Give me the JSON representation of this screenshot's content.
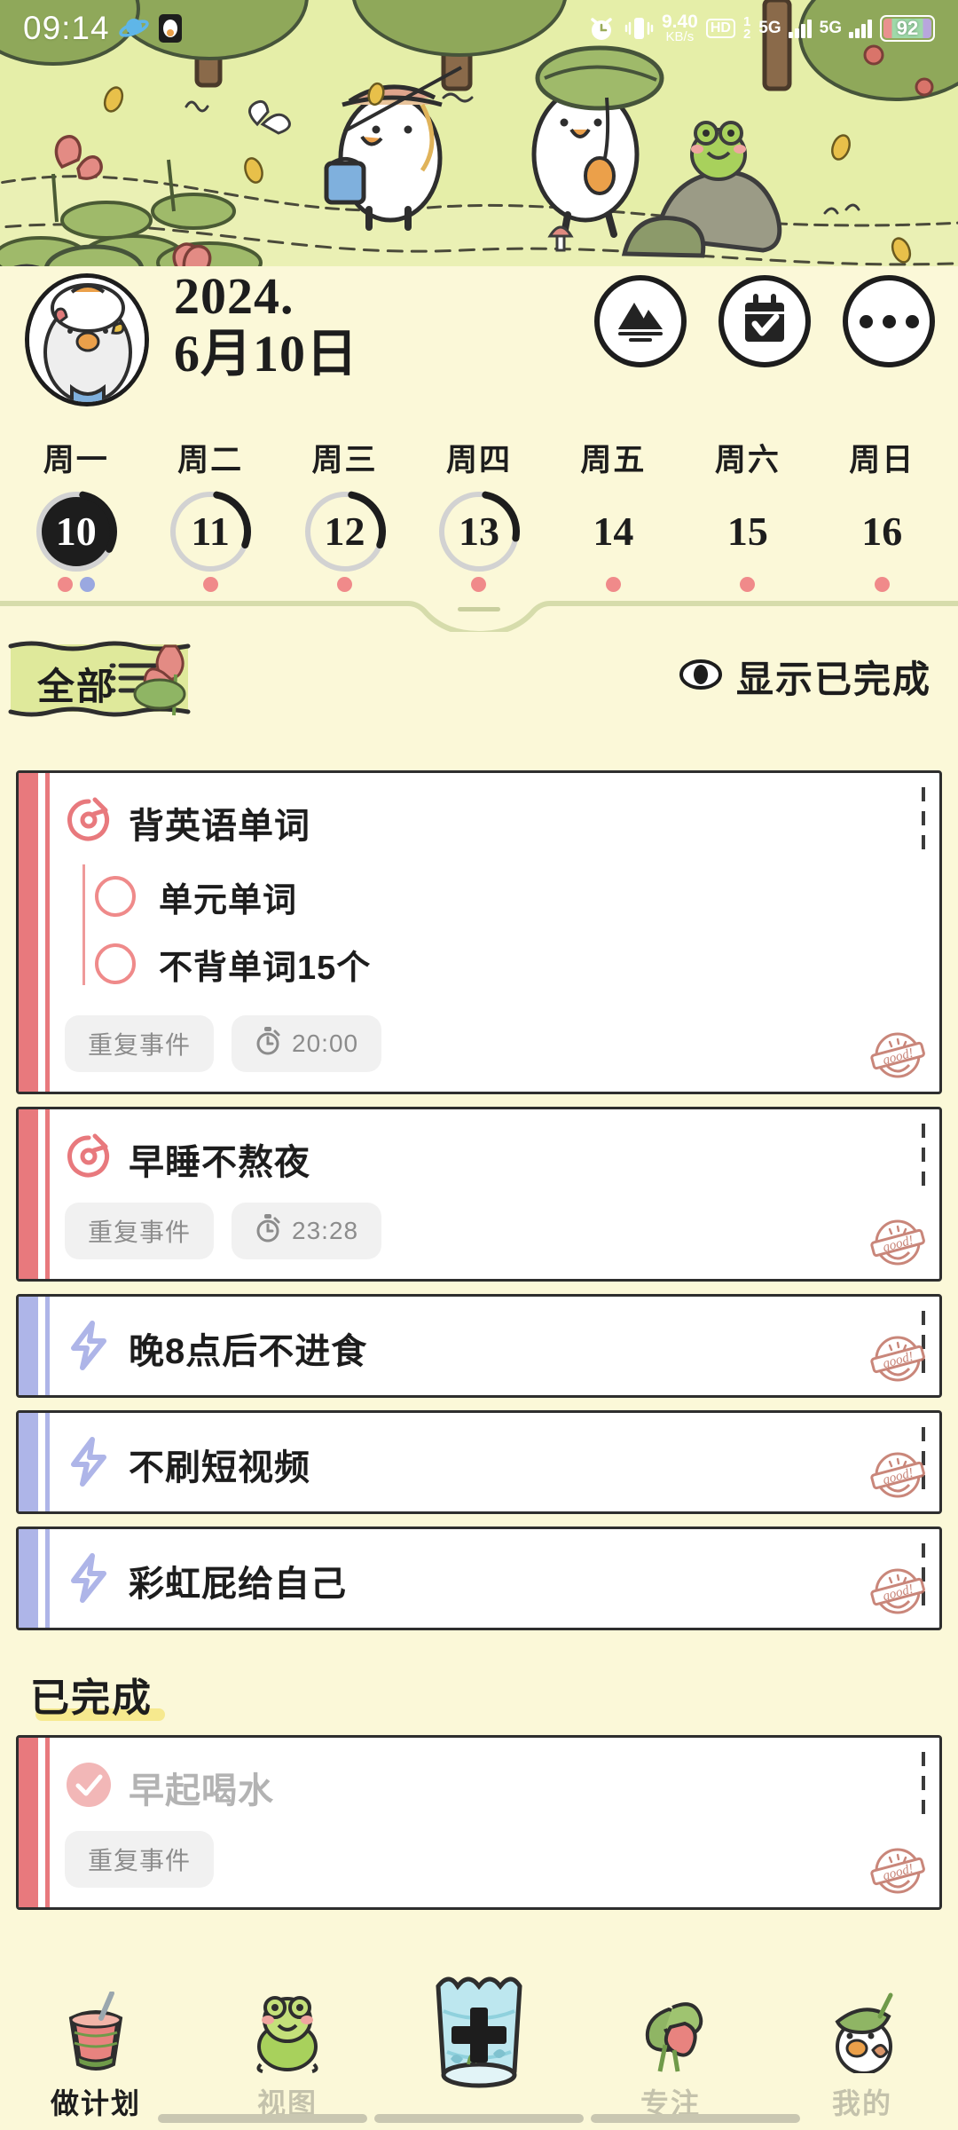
{
  "status_bar": {
    "time": "09:14",
    "icons": [
      "planet-icon",
      "app-badge-icon",
      "alarm-clock-icon",
      "vibrate-icon"
    ],
    "network_speed_value": "9.40",
    "network_speed_unit": "KB/s",
    "hd_label": "HD",
    "sim_badge": "1\n2",
    "sim1_label": "5G",
    "sim2_label": "5G",
    "battery_percent": "92"
  },
  "header": {
    "avatar_name": "duck-avatar",
    "date_line1": "2024.",
    "date_line2": "6月10日",
    "buttons": [
      {
        "name": "mountain-view-button",
        "icon": "mountain-icon"
      },
      {
        "name": "calendar-check-button",
        "icon": "calendar-check-icon"
      },
      {
        "name": "more-options-button",
        "icon": "more-dots-icon"
      }
    ]
  },
  "week": {
    "days": [
      {
        "weekday": "周一",
        "date": "10",
        "selected": true,
        "progress": 0.3,
        "dots": [
          "#f08a8a",
          "#9aa8e0"
        ]
      },
      {
        "weekday": "周二",
        "date": "11",
        "selected": false,
        "progress": 0.28,
        "dots": [
          "#f08a8a"
        ]
      },
      {
        "weekday": "周三",
        "date": "12",
        "selected": false,
        "progress": 0.28,
        "dots": [
          "#f08a8a"
        ]
      },
      {
        "weekday": "周四",
        "date": "13",
        "selected": false,
        "progress": 0.25,
        "dots": [
          "#f08a8a"
        ]
      },
      {
        "weekday": "周五",
        "date": "14",
        "selected": false,
        "progress": 0,
        "dots": [
          "#f08a8a"
        ]
      },
      {
        "weekday": "周六",
        "date": "15",
        "selected": false,
        "progress": 0,
        "dots": [
          "#f08a8a"
        ]
      },
      {
        "weekday": "周日",
        "date": "16",
        "selected": false,
        "progress": 0,
        "dots": [
          "#f08a8a"
        ]
      }
    ]
  },
  "filter_bar": {
    "category_label": "全部",
    "category_icon": "list-lines-icon",
    "decoration_icon": "lotus-flower-icon",
    "show_done_icon": "eye-icon",
    "show_done_label": "显示已完成"
  },
  "tasks": [
    {
      "title": "背英语单词",
      "type": "repeat",
      "accent": "#e8797d",
      "icon": "repeat-icon",
      "stamp": "good-stamp",
      "subtasks": [
        {
          "label": "单元单词",
          "checked": false
        },
        {
          "label": "不背单词15个",
          "checked": false
        }
      ],
      "chips": [
        {
          "label": "重复事件",
          "icon": null
        },
        {
          "label": "20:00",
          "icon": "stopwatch-icon"
        }
      ]
    },
    {
      "title": "早睡不熬夜",
      "type": "repeat",
      "accent": "#e8797d",
      "icon": "repeat-icon",
      "stamp": "good-stamp",
      "subtasks": [],
      "chips": [
        {
          "label": "重复事件",
          "icon": null
        },
        {
          "label": "23:28",
          "icon": "stopwatch-icon"
        }
      ]
    },
    {
      "title": "晚8点后不进食",
      "type": "habit",
      "accent": "#aeb5e8",
      "icon": "lightning-icon",
      "stamp": "good-stamp",
      "subtasks": [],
      "chips": []
    },
    {
      "title": "不刷短视频",
      "type": "habit",
      "accent": "#aeb5e8",
      "icon": "lightning-icon",
      "stamp": "good-stamp",
      "subtasks": [],
      "chips": []
    },
    {
      "title": "彩虹屁给自己",
      "type": "habit",
      "accent": "#aeb5e8",
      "icon": "lightning-icon",
      "stamp": "good-stamp",
      "subtasks": [],
      "chips": []
    }
  ],
  "completed_section": {
    "title": "已完成",
    "tasks": [
      {
        "title": "早起喝水",
        "accent": "#e8797d",
        "icon": "check-circle-icon",
        "stamp": "good-stamp",
        "chips": [
          {
            "label": "重复事件",
            "icon": null
          }
        ]
      }
    ]
  },
  "bottom_nav": {
    "items": [
      {
        "label": "做计划",
        "icon": "watermelon-drink-icon",
        "active": true
      },
      {
        "label": "视图",
        "icon": "frog-icon",
        "active": false
      },
      {
        "label": "",
        "icon": "fishbowl-add-icon",
        "active": false
      },
      {
        "label": "专注",
        "icon": "lotus-leaf-icon",
        "active": false
      },
      {
        "label": "我的",
        "icon": "duck-leaf-icon",
        "active": false
      }
    ]
  },
  "colors": {
    "page_bg": "#fbf8d8",
    "banner_green": "#e3eda6",
    "task_accent_red": "#e8797d",
    "task_accent_blue": "#aeb5e8",
    "highlight_yellow": "#f6e98e",
    "stamp_red": "#c07263"
  }
}
